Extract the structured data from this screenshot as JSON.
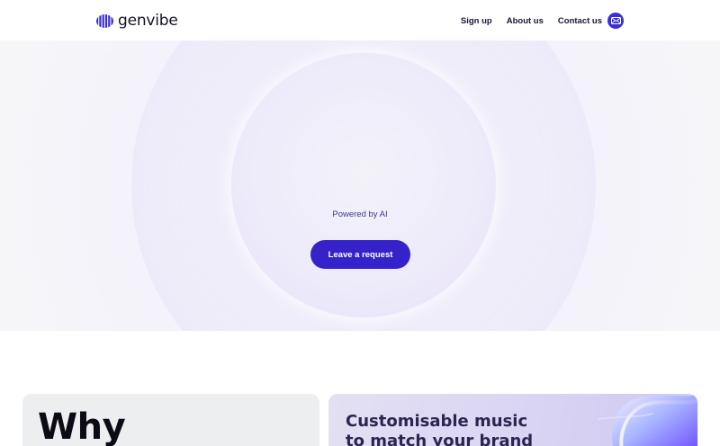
{
  "header": {
    "logo_text": "genvibe",
    "logo_icon": "striped-globe-icon",
    "nav": [
      {
        "label": "Sign up"
      },
      {
        "label": "About us"
      },
      {
        "label": "Contact us"
      }
    ],
    "mail_icon": "mail-icon",
    "accent_color": "#3b2ed6"
  },
  "hero": {
    "powered_text": "Powered by AI",
    "cta_label": "Leave a request",
    "cta_color": "#3523c9"
  },
  "cards": {
    "left": {
      "title": "Why"
    },
    "right": {
      "title_line1": "Customisable music",
      "title_line2": "to match your brand"
    }
  }
}
